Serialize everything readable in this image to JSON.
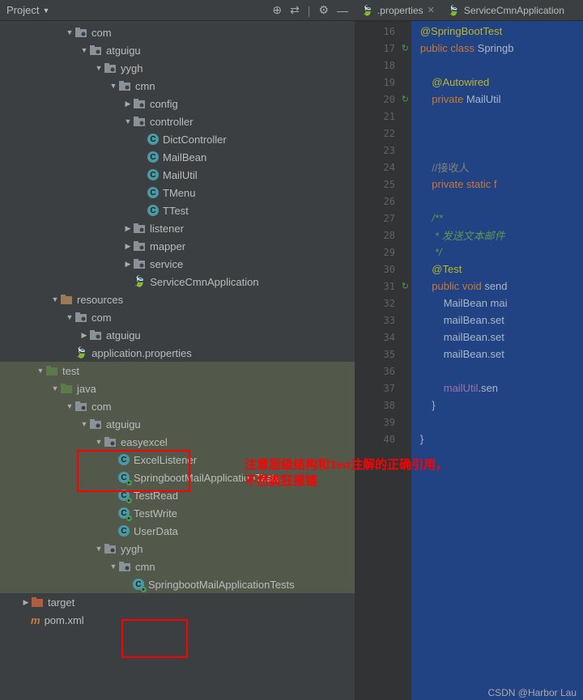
{
  "toolbar": {
    "title": "Project"
  },
  "tabs": [
    {
      "label": ".properties",
      "icon": "props"
    },
    {
      "label": "ServiceCmnApplication",
      "icon": "java"
    }
  ],
  "tree": [
    {
      "indent": 4,
      "arrow": "down",
      "icon": "pkg",
      "label": "com"
    },
    {
      "indent": 5,
      "arrow": "down",
      "icon": "pkg",
      "label": "atguigu"
    },
    {
      "indent": 6,
      "arrow": "down",
      "icon": "pkg",
      "label": "yygh"
    },
    {
      "indent": 7,
      "arrow": "down",
      "icon": "pkg",
      "label": "cmn"
    },
    {
      "indent": 8,
      "arrow": "right",
      "icon": "pkg",
      "label": "config"
    },
    {
      "indent": 8,
      "arrow": "down",
      "icon": "pkg",
      "label": "controller"
    },
    {
      "indent": 9,
      "arrow": "",
      "icon": "class",
      "label": "DictController"
    },
    {
      "indent": 9,
      "arrow": "",
      "icon": "class",
      "label": "MailBean"
    },
    {
      "indent": 9,
      "arrow": "",
      "icon": "class",
      "label": "MailUtil"
    },
    {
      "indent": 9,
      "arrow": "",
      "icon": "class",
      "label": "TMenu"
    },
    {
      "indent": 9,
      "arrow": "",
      "icon": "class",
      "label": "TTest"
    },
    {
      "indent": 8,
      "arrow": "right",
      "icon": "pkg",
      "label": "listener"
    },
    {
      "indent": 8,
      "arrow": "right",
      "icon": "pkg",
      "label": "mapper"
    },
    {
      "indent": 8,
      "arrow": "right",
      "icon": "pkg",
      "label": "service"
    },
    {
      "indent": 8,
      "arrow": "",
      "icon": "spring",
      "label": "ServiceCmnApplication"
    },
    {
      "indent": 3,
      "arrow": "down",
      "icon": "res",
      "label": "resources"
    },
    {
      "indent": 4,
      "arrow": "down",
      "icon": "pkg",
      "label": "com"
    },
    {
      "indent": 5,
      "arrow": "right",
      "icon": "pkg",
      "label": "atguigu"
    },
    {
      "indent": 4,
      "arrow": "",
      "icon": "spring",
      "label": "application.properties"
    },
    {
      "indent": 2,
      "arrow": "down",
      "icon": "testfolder",
      "label": "test",
      "test": true
    },
    {
      "indent": 3,
      "arrow": "down",
      "icon": "srcfolder",
      "label": "java",
      "test": true
    },
    {
      "indent": 4,
      "arrow": "down",
      "icon": "pkg",
      "label": "com",
      "test": true
    },
    {
      "indent": 5,
      "arrow": "down",
      "icon": "pkg",
      "label": "atguigu",
      "test": true
    },
    {
      "indent": 6,
      "arrow": "down",
      "icon": "pkg",
      "label": "easyexcel",
      "test": true
    },
    {
      "indent": 7,
      "arrow": "",
      "icon": "class",
      "label": "ExcelListener",
      "test": true
    },
    {
      "indent": 7,
      "arrow": "",
      "icon": "testclass",
      "label": "SpringbootMailApplicationTests",
      "test": true
    },
    {
      "indent": 7,
      "arrow": "",
      "icon": "testclass",
      "label": "TestRead",
      "test": true
    },
    {
      "indent": 7,
      "arrow": "",
      "icon": "testclass",
      "label": "TestWrite",
      "test": true
    },
    {
      "indent": 7,
      "arrow": "",
      "icon": "class",
      "label": "UserData",
      "test": true
    },
    {
      "indent": 6,
      "arrow": "down",
      "icon": "pkg",
      "label": "yygh",
      "test": true
    },
    {
      "indent": 7,
      "arrow": "down",
      "icon": "pkg",
      "label": "cmn",
      "test": true
    },
    {
      "indent": 8,
      "arrow": "",
      "icon": "testclass",
      "label": "SpringbootMailApplicationTests",
      "test": true
    },
    {
      "indent": 1,
      "arrow": "right",
      "icon": "excluded",
      "label": "target"
    },
    {
      "indent": 1,
      "arrow": "",
      "icon": "maven",
      "label": "pom.xml"
    }
  ],
  "code_lines": [
    {
      "num": 16,
      "gicon": "",
      "tokens": [
        [
          "anno",
          "   @SpringBootTest"
        ]
      ]
    },
    {
      "num": 17,
      "gicon": "↻",
      "tokens": [
        [
          "kw",
          "   public class "
        ],
        [
          "ident",
          "Springb"
        ]
      ]
    },
    {
      "num": 18,
      "gicon": "",
      "tokens": []
    },
    {
      "num": 19,
      "gicon": "",
      "tokens": [
        [
          "anno",
          "       @Autowired"
        ]
      ]
    },
    {
      "num": 20,
      "gicon": "↻",
      "tokens": [
        [
          "kw",
          "       private "
        ],
        [
          "ident",
          "MailUtil"
        ]
      ]
    },
    {
      "num": 21,
      "gicon": "",
      "tokens": []
    },
    {
      "num": 22,
      "gicon": "",
      "tokens": []
    },
    {
      "num": 23,
      "gicon": "",
      "tokens": []
    },
    {
      "num": 24,
      "gicon": "",
      "tokens": [
        [
          "comment",
          "       //接收人"
        ]
      ]
    },
    {
      "num": 25,
      "gicon": "",
      "tokens": [
        [
          "kw",
          "       private static f"
        ]
      ]
    },
    {
      "num": 26,
      "gicon": "",
      "tokens": []
    },
    {
      "num": 27,
      "gicon": "",
      "tokens": [
        [
          "doc",
          "       /**"
        ]
      ]
    },
    {
      "num": 28,
      "gicon": "",
      "tokens": [
        [
          "doc",
          "        * 发送文本邮件"
        ]
      ]
    },
    {
      "num": 29,
      "gicon": "",
      "tokens": [
        [
          "doc",
          "        */"
        ]
      ]
    },
    {
      "num": 30,
      "gicon": "",
      "tokens": [
        [
          "anno",
          "       @Test"
        ]
      ]
    },
    {
      "num": 31,
      "gicon": "↻",
      "tokens": [
        [
          "kw",
          "       public void "
        ],
        [
          "ident",
          "send"
        ]
      ]
    },
    {
      "num": 32,
      "gicon": "",
      "tokens": [
        [
          "normal",
          "           MailBean mai"
        ]
      ]
    },
    {
      "num": 33,
      "gicon": "",
      "tokens": [
        [
          "normal",
          "           mailBean.set"
        ]
      ]
    },
    {
      "num": 34,
      "gicon": "",
      "tokens": [
        [
          "normal",
          "           mailBean.set"
        ]
      ]
    },
    {
      "num": 35,
      "gicon": "",
      "tokens": [
        [
          "normal",
          "           mailBean.set"
        ]
      ]
    },
    {
      "num": 36,
      "gicon": "",
      "tokens": []
    },
    {
      "num": 37,
      "gicon": "",
      "tokens": [
        [
          "normal",
          "           "
        ],
        [
          "field",
          "mailUtil"
        ],
        [
          "normal",
          ".sen"
        ]
      ]
    },
    {
      "num": 38,
      "gicon": "",
      "tokens": [
        [
          "normal",
          "       }"
        ]
      ]
    },
    {
      "num": 39,
      "gicon": "",
      "tokens": []
    },
    {
      "num": 40,
      "gicon": "",
      "tokens": [
        [
          "normal",
          "   }"
        ]
      ]
    }
  ],
  "annotation": {
    "line1": "注意层级结构和Test注解的正确引用，",
    "line2": "不然疯狂报错"
  },
  "watermark": "CSDN @Harbor Lau",
  "chart_data": null
}
